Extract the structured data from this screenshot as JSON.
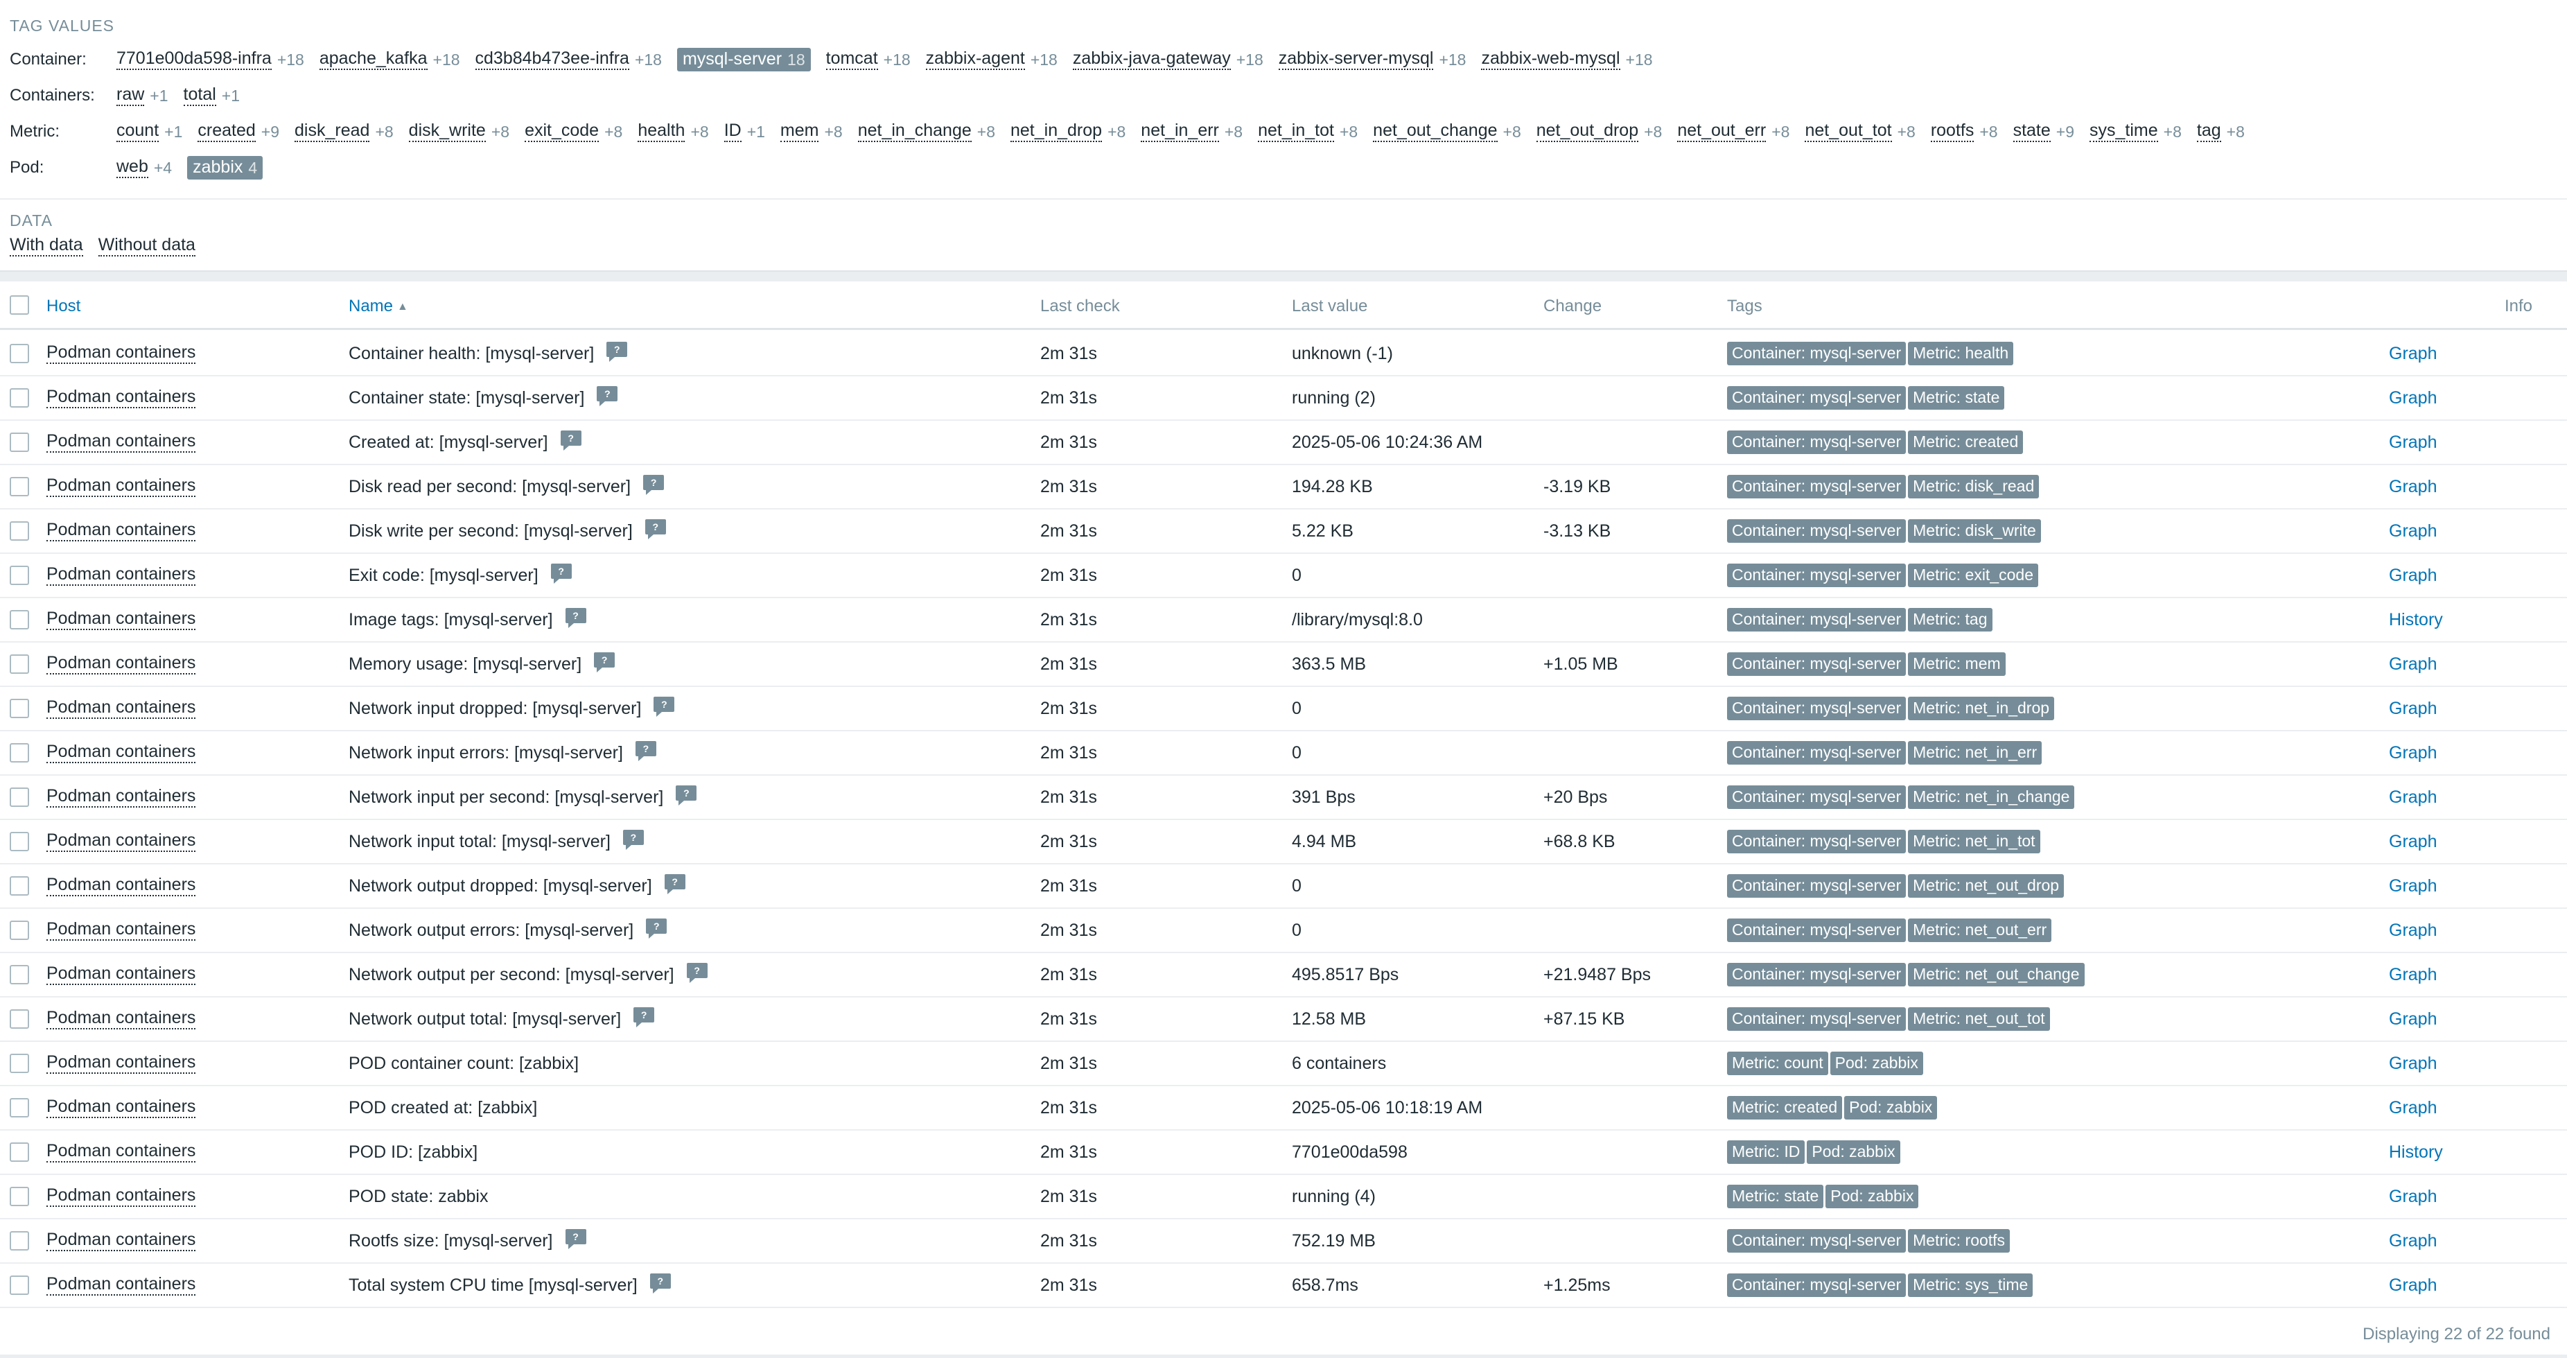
{
  "tag_values": {
    "title": "TAG VALUES",
    "rows": [
      {
        "label": "Container:",
        "values": [
          {
            "name": "7701e00da598-infra",
            "count": "+18"
          },
          {
            "name": "apache_kafka",
            "count": "+18"
          },
          {
            "name": "cd3b84b473ee-infra",
            "count": "+18"
          },
          {
            "name": "mysql-server",
            "count": "18",
            "selected": true
          },
          {
            "name": "tomcat",
            "count": "+18"
          },
          {
            "name": "zabbix-agent",
            "count": "+18"
          },
          {
            "name": "zabbix-java-gateway",
            "count": "+18"
          },
          {
            "name": "zabbix-server-mysql",
            "count": "+18"
          },
          {
            "name": "zabbix-web-mysql",
            "count": "+18"
          }
        ]
      },
      {
        "label": "Containers:",
        "values": [
          {
            "name": "raw",
            "count": "+1"
          },
          {
            "name": "total",
            "count": "+1"
          }
        ]
      },
      {
        "label": "Metric:",
        "values": [
          {
            "name": "count",
            "count": "+1"
          },
          {
            "name": "created",
            "count": "+9"
          },
          {
            "name": "disk_read",
            "count": "+8"
          },
          {
            "name": "disk_write",
            "count": "+8"
          },
          {
            "name": "exit_code",
            "count": "+8"
          },
          {
            "name": "health",
            "count": "+8"
          },
          {
            "name": "ID",
            "count": "+1"
          },
          {
            "name": "mem",
            "count": "+8"
          },
          {
            "name": "net_in_change",
            "count": "+8"
          },
          {
            "name": "net_in_drop",
            "count": "+8"
          },
          {
            "name": "net_in_err",
            "count": "+8"
          },
          {
            "name": "net_in_tot",
            "count": "+8"
          },
          {
            "name": "net_out_change",
            "count": "+8"
          },
          {
            "name": "net_out_drop",
            "count": "+8"
          },
          {
            "name": "net_out_err",
            "count": "+8"
          },
          {
            "name": "net_out_tot",
            "count": "+8"
          },
          {
            "name": "rootfs",
            "count": "+8"
          },
          {
            "name": "state",
            "count": "+9"
          },
          {
            "name": "sys_time",
            "count": "+8"
          },
          {
            "name": "tag",
            "count": "+8"
          }
        ]
      },
      {
        "label": "Pod:",
        "values": [
          {
            "name": "web",
            "count": "+4"
          },
          {
            "name": "zabbix",
            "count": "4",
            "selected": true
          }
        ]
      }
    ]
  },
  "data_filter": {
    "title": "DATA",
    "with_data": "With data",
    "without_data": "Without data"
  },
  "table": {
    "headers": {
      "host": "Host",
      "name": "Name",
      "sort_arrow": "▲",
      "last_check": "Last check",
      "last_value": "Last value",
      "change": "Change",
      "tags": "Tags",
      "info": "Info"
    },
    "hint_symbol": "?",
    "rows": [
      {
        "host": "Podman containers",
        "name": "Container health: [mysql-server]",
        "hint": true,
        "last_check": "2m 31s",
        "last_value": "unknown (-1)",
        "change": "",
        "tags": [
          "Container: mysql-server",
          "Metric: health"
        ],
        "action": "Graph"
      },
      {
        "host": "Podman containers",
        "name": "Container state: [mysql-server]",
        "hint": true,
        "last_check": "2m 31s",
        "last_value": "running (2)",
        "change": "",
        "tags": [
          "Container: mysql-server",
          "Metric: state"
        ],
        "action": "Graph"
      },
      {
        "host": "Podman containers",
        "name": "Created at: [mysql-server]",
        "hint": true,
        "last_check": "2m 31s",
        "last_value": "2025-05-06 10:24:36 AM",
        "change": "",
        "tags": [
          "Container: mysql-server",
          "Metric: created"
        ],
        "action": "Graph"
      },
      {
        "host": "Podman containers",
        "name": "Disk read per second: [mysql-server]",
        "hint": true,
        "last_check": "2m 31s",
        "last_value": "194.28 KB",
        "change": "-3.19 KB",
        "tags": [
          "Container: mysql-server",
          "Metric: disk_read"
        ],
        "action": "Graph"
      },
      {
        "host": "Podman containers",
        "name": "Disk write per second: [mysql-server]",
        "hint": true,
        "last_check": "2m 31s",
        "last_value": "5.22 KB",
        "change": "-3.13 KB",
        "tags": [
          "Container: mysql-server",
          "Metric: disk_write"
        ],
        "action": "Graph"
      },
      {
        "host": "Podman containers",
        "name": "Exit code: [mysql-server]",
        "hint": true,
        "last_check": "2m 31s",
        "last_value": "0",
        "change": "",
        "tags": [
          "Container: mysql-server",
          "Metric: exit_code"
        ],
        "action": "Graph"
      },
      {
        "host": "Podman containers",
        "name": "Image tags: [mysql-server]",
        "hint": true,
        "last_check": "2m 31s",
        "last_value": "/library/mysql:8.0",
        "change": "",
        "tags": [
          "Container: mysql-server",
          "Metric: tag"
        ],
        "action": "History"
      },
      {
        "host": "Podman containers",
        "name": "Memory usage: [mysql-server]",
        "hint": true,
        "last_check": "2m 31s",
        "last_value": "363.5 MB",
        "change": "+1.05 MB",
        "tags": [
          "Container: mysql-server",
          "Metric: mem"
        ],
        "action": "Graph"
      },
      {
        "host": "Podman containers",
        "name": "Network input dropped: [mysql-server]",
        "hint": true,
        "last_check": "2m 31s",
        "last_value": "0",
        "change": "",
        "tags": [
          "Container: mysql-server",
          "Metric: net_in_drop"
        ],
        "action": "Graph"
      },
      {
        "host": "Podman containers",
        "name": "Network input errors: [mysql-server]",
        "hint": true,
        "last_check": "2m 31s",
        "last_value": "0",
        "change": "",
        "tags": [
          "Container: mysql-server",
          "Metric: net_in_err"
        ],
        "action": "Graph"
      },
      {
        "host": "Podman containers",
        "name": "Network input per second: [mysql-server]",
        "hint": true,
        "last_check": "2m 31s",
        "last_value": "391 Bps",
        "change": "+20 Bps",
        "tags": [
          "Container: mysql-server",
          "Metric: net_in_change"
        ],
        "action": "Graph"
      },
      {
        "host": "Podman containers",
        "name": "Network input total: [mysql-server]",
        "hint": true,
        "last_check": "2m 31s",
        "last_value": "4.94 MB",
        "change": "+68.8 KB",
        "tags": [
          "Container: mysql-server",
          "Metric: net_in_tot"
        ],
        "action": "Graph"
      },
      {
        "host": "Podman containers",
        "name": "Network output dropped: [mysql-server]",
        "hint": true,
        "last_check": "2m 31s",
        "last_value": "0",
        "change": "",
        "tags": [
          "Container: mysql-server",
          "Metric: net_out_drop"
        ],
        "action": "Graph"
      },
      {
        "host": "Podman containers",
        "name": "Network output errors: [mysql-server]",
        "hint": true,
        "last_check": "2m 31s",
        "last_value": "0",
        "change": "",
        "tags": [
          "Container: mysql-server",
          "Metric: net_out_err"
        ],
        "action": "Graph"
      },
      {
        "host": "Podman containers",
        "name": "Network output per second: [mysql-server]",
        "hint": true,
        "last_check": "2m 31s",
        "last_value": "495.8517 Bps",
        "change": "+21.9487 Bps",
        "tags": [
          "Container: mysql-server",
          "Metric: net_out_change"
        ],
        "action": "Graph"
      },
      {
        "host": "Podman containers",
        "name": "Network output total: [mysql-server]",
        "hint": true,
        "last_check": "2m 31s",
        "last_value": "12.58 MB",
        "change": "+87.15 KB",
        "tags": [
          "Container: mysql-server",
          "Metric: net_out_tot"
        ],
        "action": "Graph"
      },
      {
        "host": "Podman containers",
        "name": "POD container count: [zabbix]",
        "hint": false,
        "last_check": "2m 31s",
        "last_value": "6 containers",
        "change": "",
        "tags": [
          "Metric: count",
          "Pod: zabbix"
        ],
        "action": "Graph"
      },
      {
        "host": "Podman containers",
        "name": "POD created at: [zabbix]",
        "hint": false,
        "last_check": "2m 31s",
        "last_value": "2025-05-06 10:18:19 AM",
        "change": "",
        "tags": [
          "Metric: created",
          "Pod: zabbix"
        ],
        "action": "Graph"
      },
      {
        "host": "Podman containers",
        "name": "POD ID: [zabbix]",
        "hint": false,
        "last_check": "2m 31s",
        "last_value": "7701e00da598",
        "change": "",
        "tags": [
          "Metric: ID",
          "Pod: zabbix"
        ],
        "action": "History"
      },
      {
        "host": "Podman containers",
        "name": "POD state: zabbix",
        "hint": false,
        "last_check": "2m 31s",
        "last_value": "running (4)",
        "change": "",
        "tags": [
          "Metric: state",
          "Pod: zabbix"
        ],
        "action": "Graph"
      },
      {
        "host": "Podman containers",
        "name": "Rootfs size: [mysql-server]",
        "hint": true,
        "last_check": "2m 31s",
        "last_value": "752.19 MB",
        "change": "",
        "tags": [
          "Container: mysql-server",
          "Metric: rootfs"
        ],
        "action": "Graph"
      },
      {
        "host": "Podman containers",
        "name": "Total system CPU time [mysql-server]",
        "hint": true,
        "last_check": "2m 31s",
        "last_value": "658.7ms",
        "change": "+1.25ms",
        "tags": [
          "Container: mysql-server",
          "Metric: sys_time"
        ],
        "action": "Graph"
      }
    ],
    "footer": "Displaying 22 of 22 found"
  },
  "colors": {
    "link": "#0275b8",
    "tag_bg": "#768d99",
    "muted": "#768d99",
    "text": "#1f2c33"
  }
}
